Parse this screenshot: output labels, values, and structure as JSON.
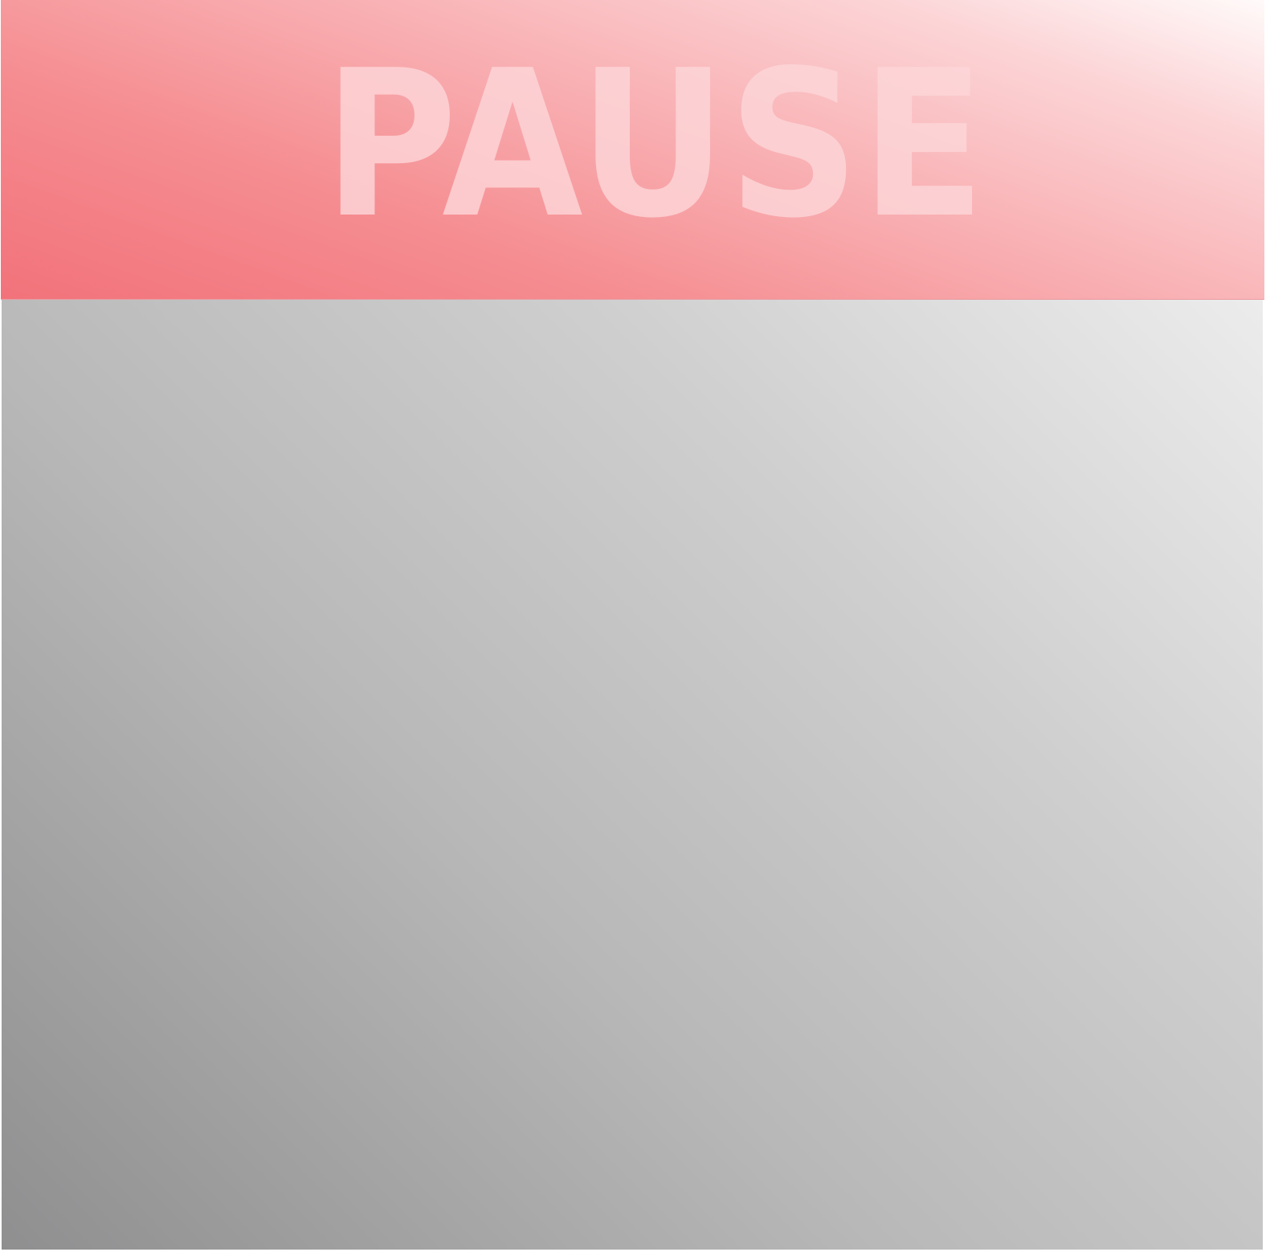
{
  "pause_screen": {
    "title": "PAUSE"
  },
  "colors": {
    "banner_accent": "#f2727a",
    "banner_light": "#fffafa",
    "title_text": "#fcd6d8",
    "game_area_light": "#ececec",
    "game_area_dark": "#8f8f90"
  }
}
